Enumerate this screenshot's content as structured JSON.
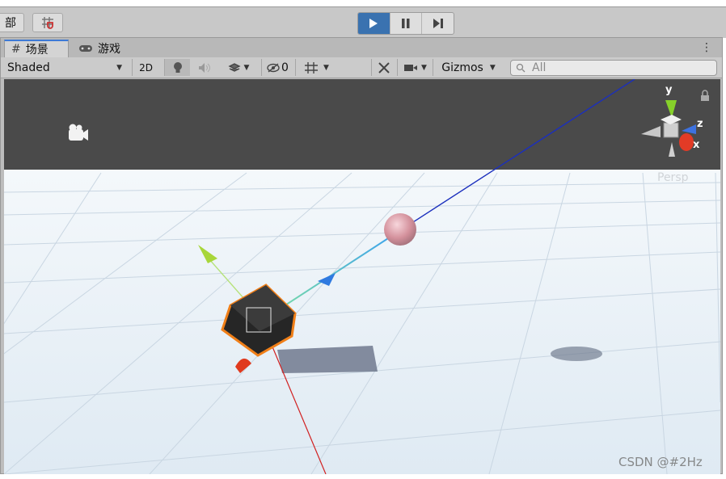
{
  "topbar": {
    "left_label": "部",
    "play_active": true
  },
  "tabs": [
    {
      "icon": "scene-hash-icon",
      "label": "场景",
      "active": true
    },
    {
      "icon": "gamepad-icon",
      "label": "游戏",
      "active": false
    }
  ],
  "toolbar": {
    "draw_mode": "Shaded",
    "mode_2d": "2D",
    "hidden_count": "0",
    "gizmos": "Gizmos",
    "search_placeholder": "All"
  },
  "viewport": {
    "projection": "Persp",
    "axes": {
      "y": "y",
      "z": "z",
      "x": "x"
    },
    "colors": {
      "x": "#e23b26",
      "y": "#86d12a",
      "z": "#3d72e0",
      "selection": "#f07f18",
      "sky": "#4a4a4a"
    }
  },
  "watermark": "CSDN @#2Hz"
}
